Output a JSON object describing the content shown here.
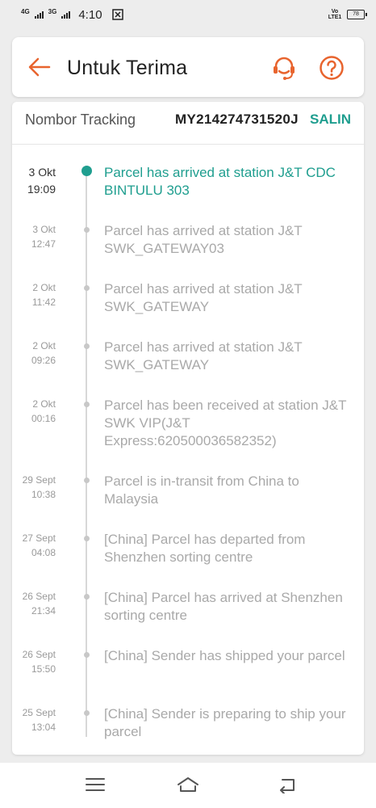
{
  "status_bar": {
    "network_1": "4G",
    "network_2": "3G",
    "time": "4:10",
    "volte": "Vo LTE1",
    "battery": "78"
  },
  "header": {
    "title": "Untuk Terima",
    "accent_color": "#e8642e"
  },
  "tracking": {
    "label": "Nombor Tracking",
    "number": "MY214274731520J",
    "copy_label": "SALIN"
  },
  "events": [
    {
      "date": "3 Okt",
      "time": "19:09",
      "text": "Parcel has arrived at station J&T CDC BINTULU 303",
      "current": true
    },
    {
      "date": "3 Okt",
      "time": "12:47",
      "text": "Parcel has arrived at station J&T SWK_GATEWAY03"
    },
    {
      "date": "2 Okt",
      "time": "11:42",
      "text": "Parcel has arrived at station J&T SWK_GATEWAY"
    },
    {
      "date": "2 Okt",
      "time": "09:26",
      "text": "Parcel has arrived at station J&T SWK_GATEWAY"
    },
    {
      "date": "2 Okt",
      "time": "00:16",
      "text": "Parcel has been received at station J&T SWK VIP(J&T Express:620500036582352)"
    },
    {
      "date": "29 Sept",
      "time": "10:38",
      "text": "Parcel is in-transit from China to Malaysia"
    },
    {
      "date": "27 Sept",
      "time": "04:08",
      "text": "[China] Parcel has departed from Shenzhen sorting centre"
    },
    {
      "date": "26 Sept",
      "time": "21:34",
      "text": "[China] Parcel has arrived at Shenzhen sorting centre"
    },
    {
      "date": "26 Sept",
      "time": "15:50",
      "text": "[China] Sender has shipped your parcel"
    },
    {
      "date": "25 Sept",
      "time": "13:04",
      "text": "[China] Sender is preparing to ship your parcel"
    }
  ],
  "colors": {
    "teal": "#1f9e8f",
    "orange": "#e8642e",
    "muted_text": "#a9a9a9"
  }
}
